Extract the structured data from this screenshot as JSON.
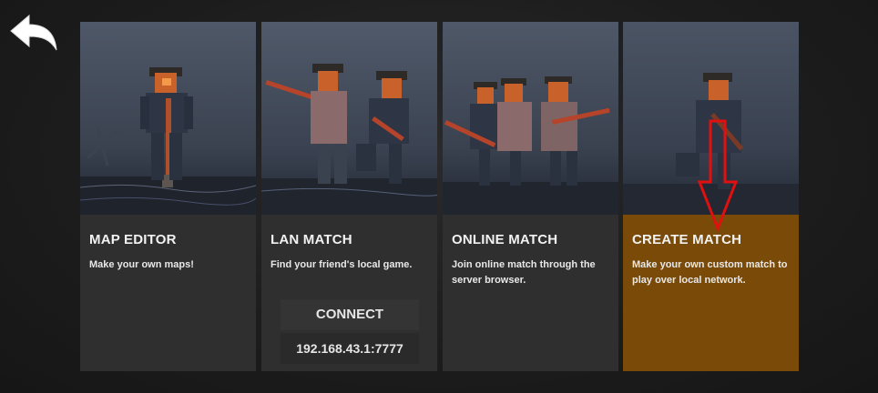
{
  "cards": [
    {
      "title": "MAP EDITOR",
      "description": "Make your own maps!"
    },
    {
      "title": "LAN MATCH",
      "description": "Find your friend's local game.",
      "connect_label": "CONNECT",
      "address": "192.168.43.1:7777"
    },
    {
      "title": "ONLINE MATCH",
      "description": "Join online match through the server browser."
    },
    {
      "title": "CREATE MATCH",
      "description": "Make your own custom match to play over local network."
    }
  ],
  "colors": {
    "card_background": "#2f2f2f",
    "highlight_card": "#7a4b08",
    "annotation_arrow": "#e01010"
  },
  "icons": {
    "back": "back-arrow-icon",
    "annotation": "red-down-arrow"
  }
}
